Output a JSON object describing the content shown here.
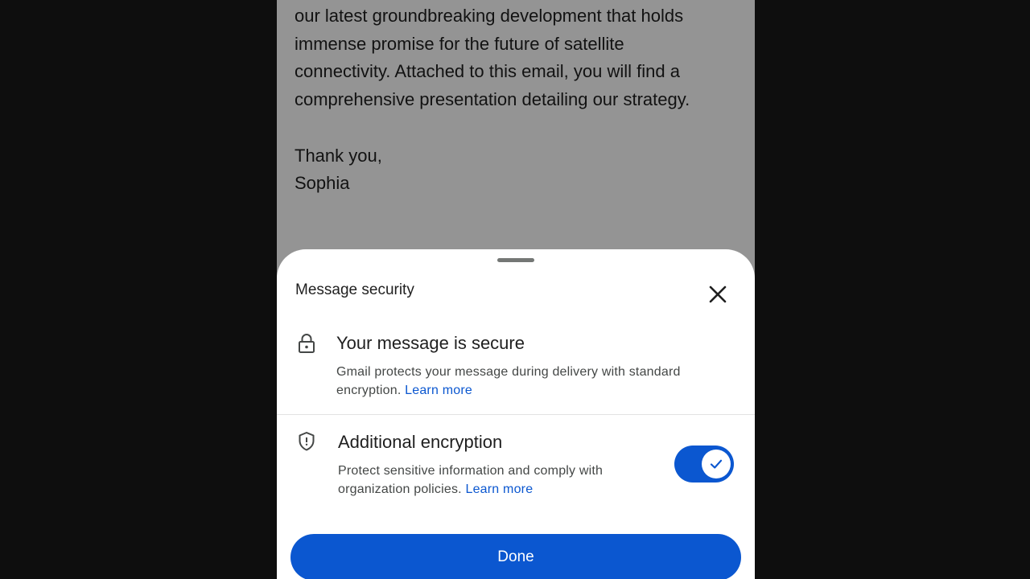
{
  "email": {
    "lines": [
      "our latest groundbreaking development that holds",
      "immense promise for the future of satellite",
      "connectivity. Attached to this email, you will find a",
      "comprehensive presentation detailing our strategy."
    ],
    "closing": "Thank you,",
    "signature": "Sophia"
  },
  "sheet": {
    "title": "Message security",
    "close_icon": "close-icon",
    "secure": {
      "icon": "lock-icon",
      "title": "Your message is secure",
      "desc_line1": "Gmail protects your message during delivery with standard",
      "desc_line2_prefix": "encryption.",
      "learn_more": "Learn more"
    },
    "encryption": {
      "icon": "shield-icon",
      "title": "Additional encryption",
      "desc_line1": "Protect sensitive information and comply with",
      "desc_line2_prefix": "organization policies.",
      "learn_more": "Learn more",
      "toggle_on": true
    },
    "done_label": "Done"
  },
  "colors": {
    "accent": "#0b57d0",
    "scrim": "#000000",
    "text_primary": "#1f1f1f",
    "text_secondary": "#444746"
  }
}
